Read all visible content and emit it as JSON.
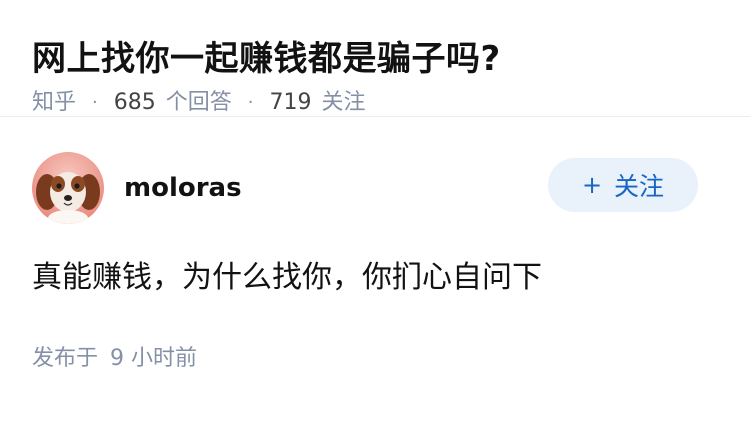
{
  "question": {
    "title": "网上找你一起赚钱都是骗子吗?",
    "source": "知乎",
    "answer_count": "685",
    "answer_label": "个回答",
    "follower_count": "719",
    "follower_label": "关注"
  },
  "answer": {
    "author_name": "moloras",
    "follow_button_label": "关注",
    "content": "真能赚钱，为什么找你，你扪心自问下",
    "publish_label": "发布于",
    "publish_time": "9 小时前"
  },
  "colors": {
    "meta": "#8590a6",
    "accent": "#1766c2",
    "follow_bg": "#e9f1fa"
  },
  "icons": {
    "avatar": "dog-avatar"
  }
}
